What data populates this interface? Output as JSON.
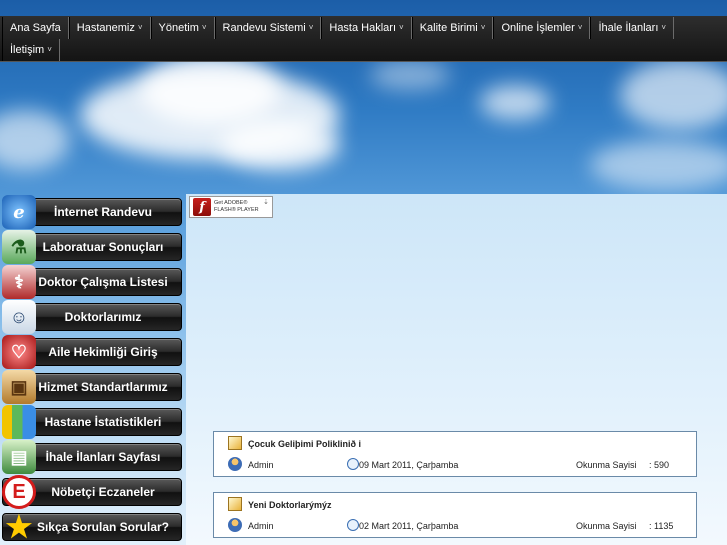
{
  "nav": {
    "row1": [
      {
        "label": "Ana Sayfa",
        "dropdown": false
      },
      {
        "label": "Hastanemiz",
        "dropdown": true
      },
      {
        "label": "Yönetim",
        "dropdown": true
      },
      {
        "label": "Randevu Sistemi",
        "dropdown": true
      },
      {
        "label": "Hasta Hakları",
        "dropdown": true
      },
      {
        "label": "Kalite Birimi",
        "dropdown": true
      },
      {
        "label": "Online İşlemler",
        "dropdown": true
      },
      {
        "label": "İhale İlanları",
        "dropdown": true
      }
    ],
    "row2": [
      {
        "label": "İletişim",
        "dropdown": true
      }
    ],
    "chevron": "˅"
  },
  "sidebar": {
    "items": [
      {
        "label": "İnternet Randevu",
        "icon": "internet-explorer-icon"
      },
      {
        "label": "Laboratuar Sonuçları",
        "icon": "flask-icon"
      },
      {
        "label": "Doktor Çalışma Listesi",
        "icon": "stethoscope-icon"
      },
      {
        "label": "Doktorlarımız",
        "icon": "doctor-icon"
      },
      {
        "label": "Aile Hekimliği Giriş",
        "icon": "stethoscope-red-icon"
      },
      {
        "label": "Hizmet Standartlarımız",
        "icon": "box-icon"
      },
      {
        "label": "Hastane İstatistikleri",
        "icon": "bar-chart-icon"
      },
      {
        "label": "İhale İlanları Sayfası",
        "icon": "folder-icon"
      },
      {
        "label": "Nöbetçi Eczaneler",
        "icon": "pharmacy-e-icon"
      },
      {
        "label": "Sıkça Sorulan Sorular?",
        "icon": "star-icon"
      }
    ]
  },
  "flash_badge": {
    "line1": "Get ADOBE®",
    "line2": "FLASH® PLAYER",
    "logo": "f"
  },
  "news": [
    {
      "title": "Çocuk Geliþimi Poliklinið i",
      "author": "Admin",
      "date": "09 Mart 2011, Çarþamba",
      "reads_label": "Okunma Sayisi",
      "reads": ": 590"
    },
    {
      "title": "Yeni Doktorlarýmýz",
      "author": "Admin",
      "date": "02 Mart 2011, Çarþamba",
      "reads_label": "Okunma Sayisi",
      "reads": ": 1135"
    }
  ],
  "colors": {
    "nav_bg": "#1e1e1e",
    "button_bg": "#222222",
    "sky_top": "#1c5ea8",
    "panel": "#e2f1fc"
  }
}
